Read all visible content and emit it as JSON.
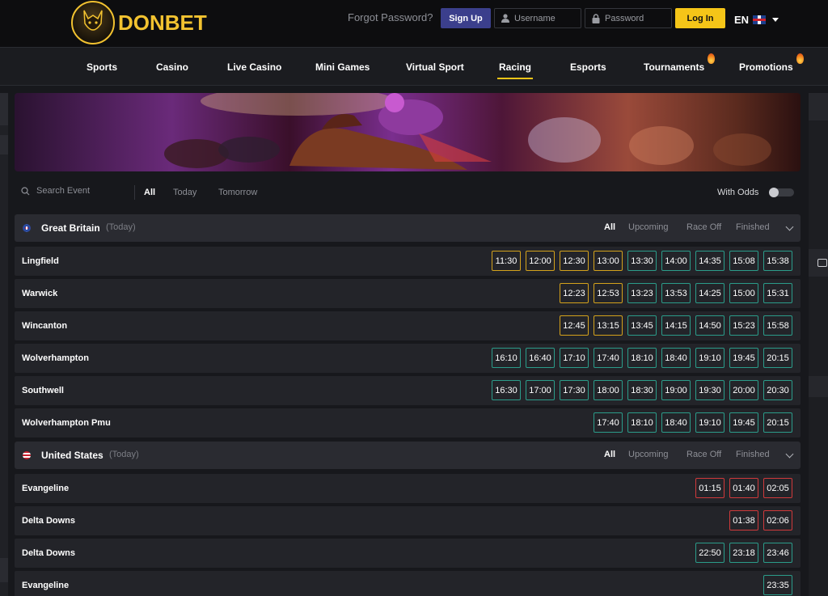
{
  "header": {
    "brand": "DONBET",
    "forgot_password": "Forgot Password?",
    "signup_label": "Sign Up",
    "username_placeholder": "Username",
    "password_placeholder": "Password",
    "login_label": "Log In",
    "language": "EN"
  },
  "nav": {
    "items": [
      "Sports",
      "Casino",
      "Live Casino",
      "Mini Games",
      "Virtual Sport",
      "Racing",
      "Esports",
      "Tournaments",
      "Promotions"
    ],
    "active": "Racing"
  },
  "filters": {
    "search_placeholder": "Search Event",
    "tabs": [
      "All",
      "Today",
      "Tomorrow"
    ],
    "active_tab": "All",
    "with_odds_label": "With Odds",
    "with_odds_on": false
  },
  "countries": [
    {
      "name": "Great Britain",
      "day": "(Today)",
      "tabs": [
        "All",
        "Upcoming",
        "Race Off",
        "Finished"
      ],
      "races": [
        {
          "name": "Lingfield",
          "times": [
            {
              "t": "11:30",
              "s": "finished"
            },
            {
              "t": "12:00",
              "s": "finished"
            },
            {
              "t": "12:30",
              "s": "finished"
            },
            {
              "t": "13:00",
              "s": "finished"
            },
            {
              "t": "13:30",
              "s": "upcoming"
            },
            {
              "t": "14:00",
              "s": "upcoming"
            },
            {
              "t": "14:35",
              "s": "upcoming"
            },
            {
              "t": "15:08",
              "s": "upcoming"
            },
            {
              "t": "15:38",
              "s": "upcoming"
            }
          ]
        },
        {
          "name": "Warwick",
          "times": [
            {
              "t": "12:23",
              "s": "finished"
            },
            {
              "t": "12:53",
              "s": "finished"
            },
            {
              "t": "13:23",
              "s": "upcoming"
            },
            {
              "t": "13:53",
              "s": "upcoming"
            },
            {
              "t": "14:25",
              "s": "upcoming"
            },
            {
              "t": "15:00",
              "s": "upcoming"
            },
            {
              "t": "15:31",
              "s": "upcoming"
            }
          ]
        },
        {
          "name": "Wincanton",
          "times": [
            {
              "t": "12:45",
              "s": "finished"
            },
            {
              "t": "13:15",
              "s": "finished"
            },
            {
              "t": "13:45",
              "s": "upcoming"
            },
            {
              "t": "14:15",
              "s": "upcoming"
            },
            {
              "t": "14:50",
              "s": "upcoming"
            },
            {
              "t": "15:23",
              "s": "upcoming"
            },
            {
              "t": "15:58",
              "s": "upcoming"
            }
          ]
        },
        {
          "name": "Wolverhampton",
          "times": [
            {
              "t": "16:10",
              "s": "upcoming"
            },
            {
              "t": "16:40",
              "s": "upcoming"
            },
            {
              "t": "17:10",
              "s": "upcoming"
            },
            {
              "t": "17:40",
              "s": "upcoming"
            },
            {
              "t": "18:10",
              "s": "upcoming"
            },
            {
              "t": "18:40",
              "s": "upcoming"
            },
            {
              "t": "19:10",
              "s": "upcoming"
            },
            {
              "t": "19:45",
              "s": "upcoming"
            },
            {
              "t": "20:15",
              "s": "upcoming"
            }
          ]
        },
        {
          "name": "Southwell",
          "times": [
            {
              "t": "16:30",
              "s": "upcoming"
            },
            {
              "t": "17:00",
              "s": "upcoming"
            },
            {
              "t": "17:30",
              "s": "upcoming"
            },
            {
              "t": "18:00",
              "s": "upcoming"
            },
            {
              "t": "18:30",
              "s": "upcoming"
            },
            {
              "t": "19:00",
              "s": "upcoming"
            },
            {
              "t": "19:30",
              "s": "upcoming"
            },
            {
              "t": "20:00",
              "s": "upcoming"
            },
            {
              "t": "20:30",
              "s": "upcoming"
            }
          ]
        },
        {
          "name": "Wolverhampton Pmu",
          "times": [
            {
              "t": "17:40",
              "s": "upcoming"
            },
            {
              "t": "18:10",
              "s": "upcoming"
            },
            {
              "t": "18:40",
              "s": "upcoming"
            },
            {
              "t": "19:10",
              "s": "upcoming"
            },
            {
              "t": "19:45",
              "s": "upcoming"
            },
            {
              "t": "20:15",
              "s": "upcoming"
            }
          ]
        }
      ]
    },
    {
      "name": "United States",
      "day": "(Today)",
      "tabs": [
        "All",
        "Upcoming",
        "Race Off",
        "Finished"
      ],
      "races": [
        {
          "name": "Evangeline",
          "times": [
            {
              "t": "01:15",
              "s": "off"
            },
            {
              "t": "01:40",
              "s": "off"
            },
            {
              "t": "02:05",
              "s": "off"
            }
          ]
        },
        {
          "name": "Delta Downs",
          "times": [
            {
              "t": "01:38",
              "s": "off"
            },
            {
              "t": "02:06",
              "s": "off"
            }
          ]
        },
        {
          "name": "Delta Downs",
          "times": [
            {
              "t": "22:50",
              "s": "upcoming"
            },
            {
              "t": "23:18",
              "s": "upcoming"
            },
            {
              "t": "23:46",
              "s": "upcoming"
            }
          ]
        },
        {
          "name": "Evangeline",
          "times": [
            {
              "t": "23:35",
              "s": "upcoming"
            }
          ]
        }
      ]
    }
  ],
  "colors": {
    "accent": "#f5c518",
    "upcoming": "#2b9c8a",
    "finished": "#d4a21c",
    "race_off": "#d0393b",
    "signup": "#3b3f8c"
  }
}
